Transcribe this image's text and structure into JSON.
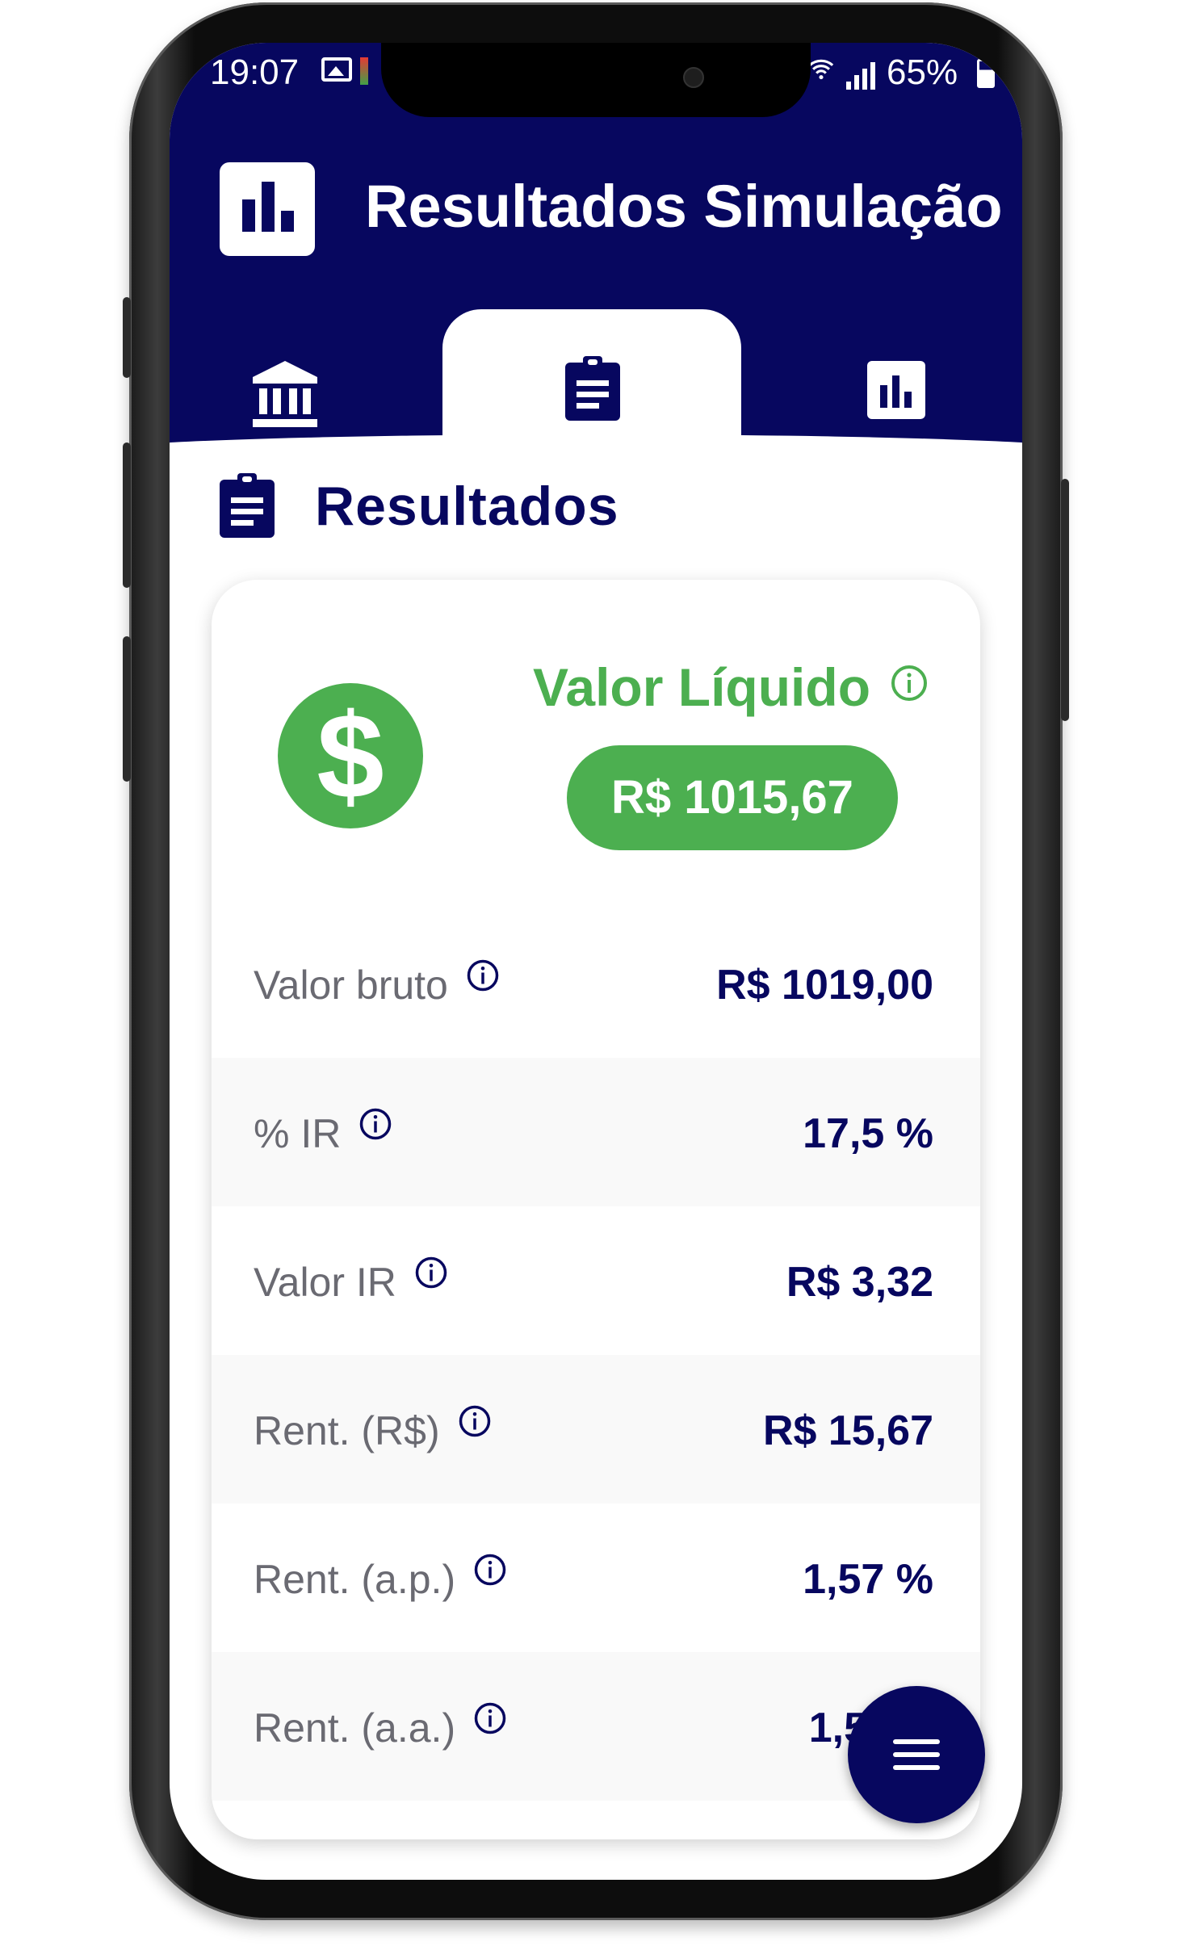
{
  "status_bar": {
    "time": "19:07",
    "battery": "65%"
  },
  "header": {
    "title": "Resultados Simulação",
    "logo_icon": "bar-chart-icon",
    "tabs": [
      {
        "icon": "bank-icon",
        "active": false
      },
      {
        "icon": "clipboard-icon",
        "active": true
      },
      {
        "icon": "bar-chart-icon",
        "active": false
      }
    ]
  },
  "section": {
    "title": "Resultados",
    "icon": "clipboard-icon"
  },
  "summary": {
    "label": "Valor Líquido",
    "value": "R$ 1015,67",
    "icon": "dollar-icon"
  },
  "rows": [
    {
      "label": "Valor bruto",
      "value": "R$ 1019,00"
    },
    {
      "label": "% IR",
      "value": "17,5 %"
    },
    {
      "label": "Valor IR",
      "value": "R$ 3,32"
    },
    {
      "label": "Rent. (R$)",
      "value": "R$ 15,67"
    },
    {
      "label": "Rent. (a.p.)",
      "value": "1,57 %"
    },
    {
      "label": "Rent. (a.a.)",
      "value": "1,5"
    }
  ],
  "colors": {
    "primary": "#07075f",
    "accent_green": "#4caf50",
    "label_gray": "#6a6a72",
    "row_shade": "#f9f9f9"
  },
  "fab": {
    "icon": "menu-icon"
  }
}
